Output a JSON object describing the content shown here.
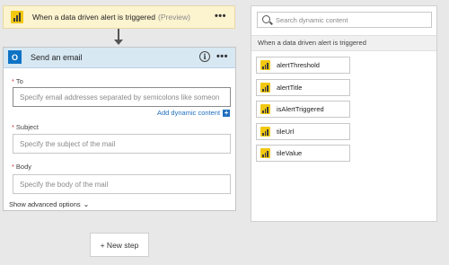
{
  "trigger": {
    "title": "When a data driven alert is triggered",
    "preview": "(Preview)",
    "menu": "•••"
  },
  "action": {
    "title": "Send an email",
    "info": "i",
    "menu": "•••",
    "icon_letter": "O",
    "fields": [
      {
        "label": "To",
        "required": "*",
        "placeholder": "Specify email addresses separated by semicolons like someon"
      },
      {
        "label": "Subject",
        "required": "*",
        "placeholder": "Specify the subject of the mail"
      },
      {
        "label": "Body",
        "required": "*",
        "placeholder": "Specify the body of the mail"
      }
    ],
    "add_dynamic": "Add dynamic content",
    "add_dynamic_plus": "+",
    "show_advanced": "Show advanced options",
    "show_advanced_chevron": "⌄"
  },
  "panel": {
    "search_placeholder": "Search dynamic content",
    "section": "When a data driven alert is triggered",
    "tokens": [
      "alertThreshold",
      "alertTitle",
      "isAlertTriggered",
      "tileUrl",
      "tileValue"
    ]
  },
  "new_step": "+ New step",
  "colors": {
    "trigger_bg": "#fcf3cf",
    "header_bg": "#d7e8f3",
    "powerbi_yellow": "#f2c811",
    "outlook_blue": "#0f73c5",
    "link_blue": "#1f6fbf",
    "required_red": "#d13438"
  }
}
